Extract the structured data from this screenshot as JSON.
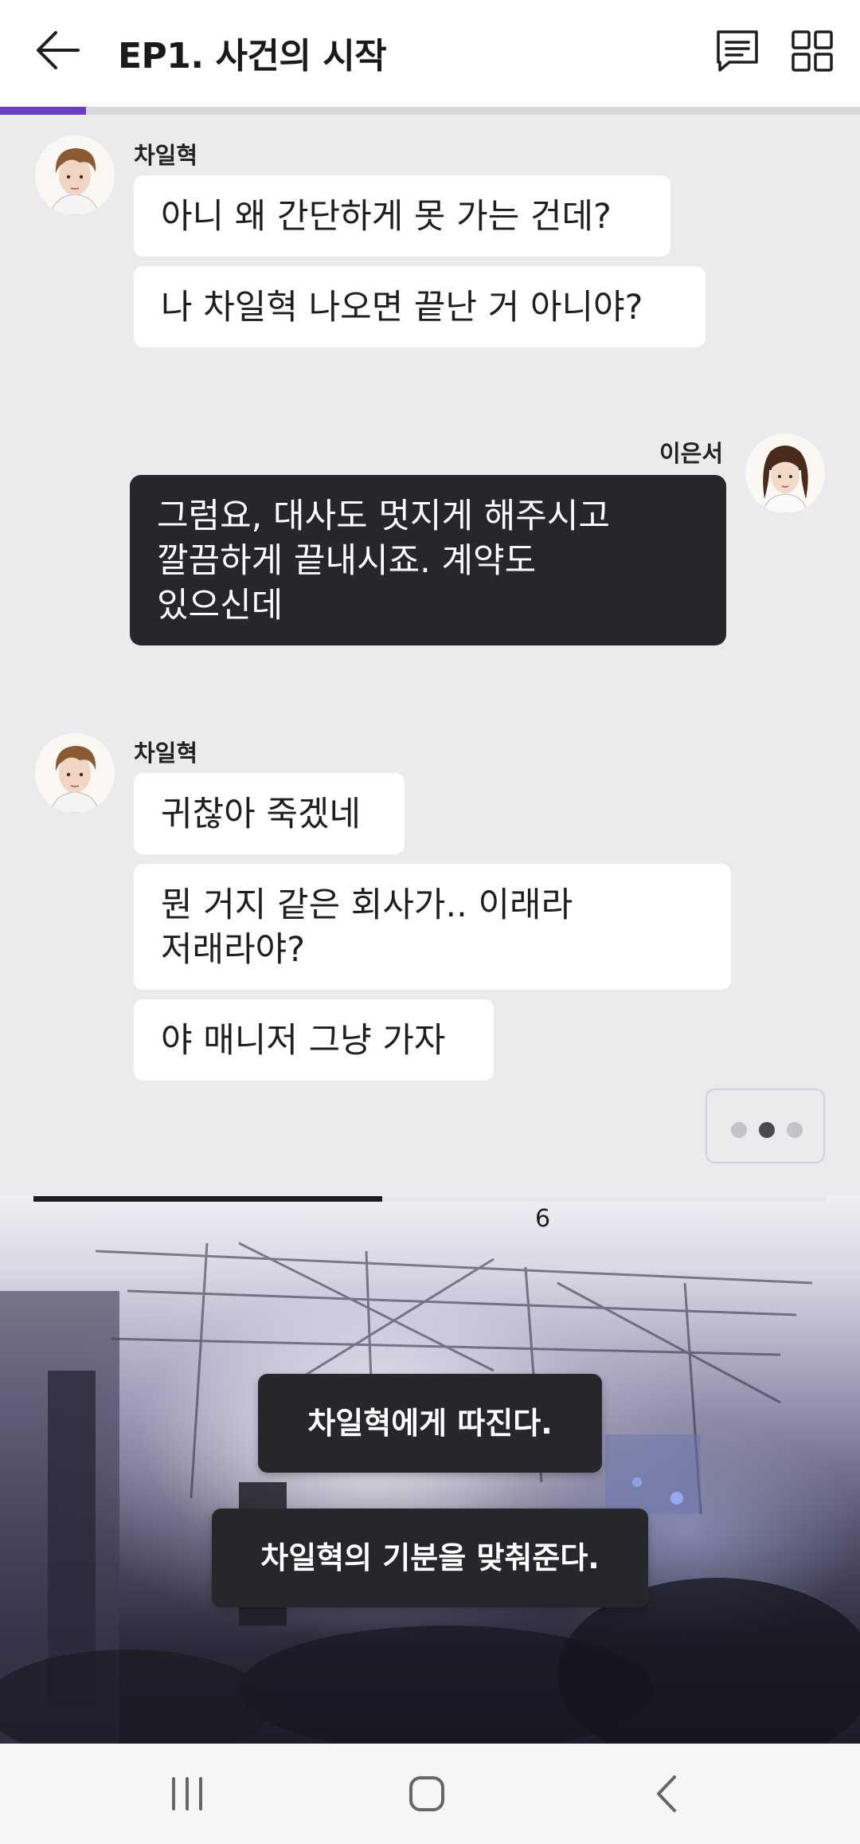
{
  "header": {
    "title": "EP1. 사건의 시작",
    "episode_progress": 0.1
  },
  "chat": {
    "groups": [
      {
        "speaker": "차일혁",
        "side": "left",
        "messages": [
          "아니 왜 간단하게 못 가는 건데?",
          "나 차일혁 나오면 끝난 거 아니야?"
        ]
      },
      {
        "speaker": "이은서",
        "side": "right",
        "messages": [
          "그럼요, 대사도 멋지게 해주시고\n깔끔하게 끝내시죠. 계약도\n있으신데"
        ]
      },
      {
        "speaker": "차일혁",
        "side": "left",
        "messages": [
          "귀찮아 죽겠네",
          "뭔 거지 같은 회사가.. 이래라\n저래라야?",
          "야 매니저 그냥 가자"
        ]
      }
    ],
    "typing_indicator_active_dot": 2
  },
  "choice_panel": {
    "timer_value": "6",
    "timer_progress": 0.44,
    "choices": [
      "차일혁에게 따진다.",
      "차일혁의 기분을 맞춰준다."
    ]
  },
  "colors": {
    "accent": "#6b3ec6",
    "dark_bubble": "#26272b",
    "background": "#ebebed"
  },
  "icons": {
    "back": "back-arrow-icon",
    "chat": "chat-list-icon",
    "grid": "grid-menu-icon",
    "nav_recent": "recent-apps-icon",
    "nav_home": "home-icon",
    "nav_back": "nav-back-icon"
  }
}
